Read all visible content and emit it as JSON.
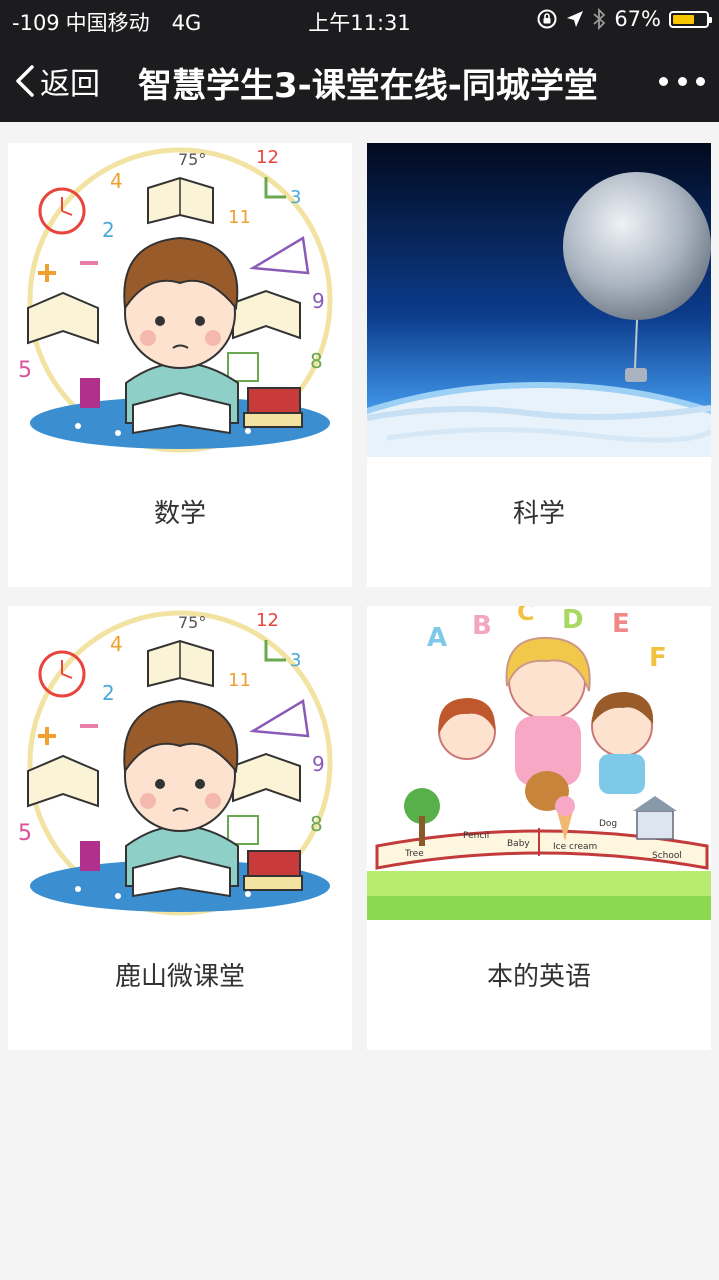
{
  "status_bar": {
    "signal": "-109",
    "carrier": "中国移动",
    "network": "4G",
    "time": "上午11:31",
    "battery": "67%",
    "battery_level": 0.67,
    "battery_color": "#f7c600"
  },
  "nav": {
    "back_label": "返回",
    "title": "智慧学生3-课堂在线-同城学堂",
    "more_icon": "more-dots-icon"
  },
  "courses": [
    {
      "label": "数学",
      "image": "cartoon-boy-studying-math"
    },
    {
      "label": "科学",
      "image": "space-balloon-over-earth"
    },
    {
      "label": "鹿山微课堂",
      "image": "cartoon-boy-studying-math"
    },
    {
      "label": "本的英语",
      "image": "family-reading-book-abc"
    }
  ],
  "colors": {
    "header_bg": "#1c1c1f",
    "page_bg": "#f4f4f4",
    "card_bg": "#ffffff"
  }
}
